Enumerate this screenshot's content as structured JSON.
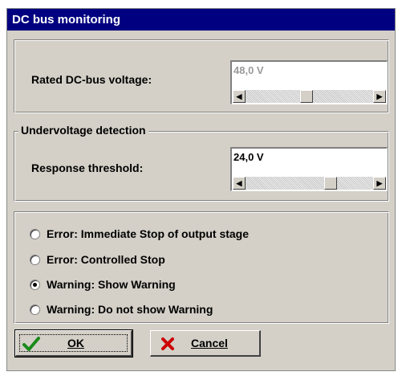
{
  "window": {
    "title": "DC bus monitoring"
  },
  "dc_bus": {
    "rated_label": "Rated DC-bus voltage:",
    "rated_value": "48,0 V"
  },
  "undervoltage": {
    "group_title": "Undervoltage detection",
    "threshold_label": "Response threshold:",
    "threshold_value": "24,0 V"
  },
  "options": {
    "items": [
      {
        "label": "Error: Immediate Stop of output stage",
        "checked": false
      },
      {
        "label": "Error: Controlled Stop",
        "checked": false
      },
      {
        "label": "Warning: Show Warning",
        "checked": true
      },
      {
        "label": "Warning: Do not show Warning",
        "checked": false
      }
    ]
  },
  "buttons": {
    "ok_label": "OK",
    "cancel_label": "Cancel"
  },
  "icons": {
    "ok": "checkmark-icon",
    "cancel": "x-icon",
    "scroll_left": "arrow-left-icon",
    "scroll_right": "arrow-right-icon"
  },
  "colors": {
    "titlebar": "#000080",
    "dialog_bg": "#d4d0c8",
    "ok_check": "#1a8a1a",
    "cancel_x": "#cc0000"
  }
}
